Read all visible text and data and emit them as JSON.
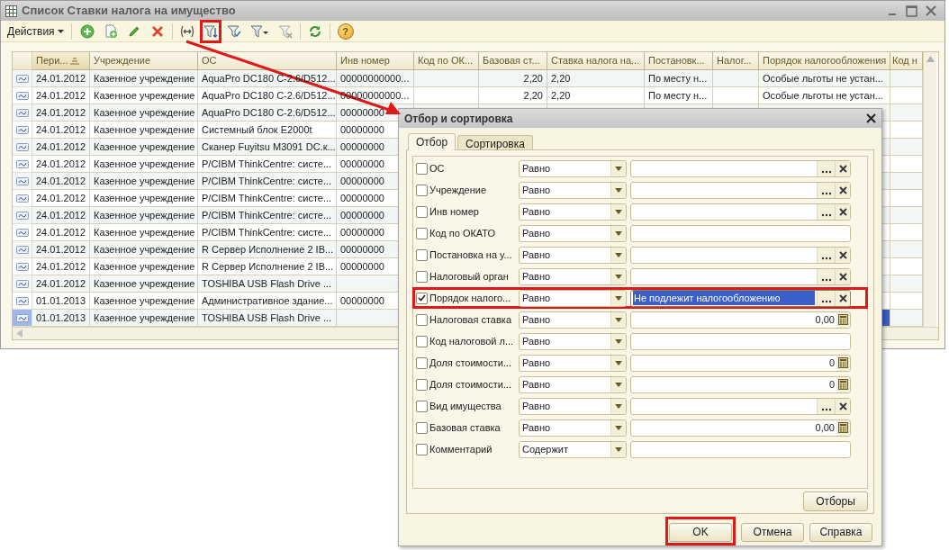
{
  "window": {
    "title": "Список Ставки налога на имущество"
  },
  "toolbar": {
    "actions_label": "Действия",
    "buttons": [
      {
        "kind": "add",
        "annotated": false
      },
      {
        "kind": "copy",
        "annotated": false
      },
      {
        "kind": "edit",
        "annotated": false
      },
      {
        "kind": "delete",
        "annotated": false
      },
      {
        "kind": "interval",
        "annotated": false
      },
      {
        "kind": "filter-sort",
        "annotated": true
      },
      {
        "kind": "filter-value",
        "annotated": false
      },
      {
        "kind": "filter-menu",
        "annotated": false
      },
      {
        "kind": "filter-clear",
        "annotated": false
      },
      {
        "kind": "refresh",
        "annotated": false
      },
      {
        "kind": "help",
        "annotated": false,
        "glyph": "?"
      }
    ]
  },
  "table": {
    "columns": [
      {
        "label": "Пери...",
        "sorted": true
      },
      {
        "label": "Учреждение",
        "sorted": false
      },
      {
        "label": "ОС",
        "sorted": false
      },
      {
        "label": "Инв номер",
        "sorted": false
      },
      {
        "label": "Код по ОК...",
        "sorted": false
      },
      {
        "label": "Базовая ст...",
        "sorted": false
      },
      {
        "label": "Ставка налога на...",
        "sorted": false
      },
      {
        "label": "Постановк...",
        "sorted": false
      },
      {
        "label": "Налог...",
        "sorted": false
      },
      {
        "label": "Порядок налогообложения",
        "sorted": false
      },
      {
        "label": "Код н",
        "sorted": false
      }
    ],
    "rows": [
      {
        "selected": false,
        "cells": [
          "24.01.2012",
          "Казенное учреждение",
          "AquaPro DC180 C-2.6/D512...",
          "00000000000...",
          null,
          "2,20",
          "2,20",
          "По месту н...",
          null,
          "Особые льготы не устан...",
          null
        ]
      },
      {
        "selected": false,
        "cells": [
          "24.01.2012",
          "Казенное учреждение",
          "AquaPro DC180 C-2.6/D512...",
          "00000000000...",
          null,
          "2,20",
          "2,20",
          "По месту н...",
          null,
          "Особые льготы не устан...",
          null
        ]
      },
      {
        "selected": false,
        "cells": [
          "24.01.2012",
          "Казенное учреждение",
          "AquaPro DC180 C-2.6/D512...",
          "00000000"
        ]
      },
      {
        "selected": false,
        "cells": [
          "24.01.2012",
          "Казенное учреждение",
          "Системный блок E2000t",
          "00000000"
        ]
      },
      {
        "selected": false,
        "cells": [
          "24.01.2012",
          "Казенное учреждение",
          "Сканер Fuyitsu M3091 DC.к...",
          "00000000"
        ]
      },
      {
        "selected": false,
        "cells": [
          "24.01.2012",
          "Казенное учреждение",
          "P/CIBM ThinkCentre: систе...",
          "00000000"
        ]
      },
      {
        "selected": false,
        "cells": [
          "24.01.2012",
          "Казенное учреждение",
          "P/CIBM ThinkCentre: систе...",
          "00000000"
        ]
      },
      {
        "selected": false,
        "cells": [
          "24.01.2012",
          "Казенное учреждение",
          "P/CIBM ThinkCentre: систе...",
          "00000000"
        ]
      },
      {
        "selected": false,
        "cells": [
          "24.01.2012",
          "Казенное учреждение",
          "P/CIBM ThinkCentre: систе...",
          "00000000"
        ]
      },
      {
        "selected": false,
        "cells": [
          "24.01.2012",
          "Казенное учреждение",
          "P/CIBM ThinkCentre: систе...",
          "00000000"
        ]
      },
      {
        "selected": false,
        "cells": [
          "24.01.2012",
          "Казенное учреждение",
          "R Сервер Исполнение 2 IB...",
          "00000000"
        ]
      },
      {
        "selected": false,
        "cells": [
          "24.01.2012",
          "Казенное учреждение",
          "R Сервер Исполнение 2 IB...",
          "00000000"
        ]
      },
      {
        "selected": false,
        "cells": [
          "24.01.2012",
          "Казенное учреждение",
          "TOSHIBA USB Flash Drive ...",
          null
        ]
      },
      {
        "selected": false,
        "cells": [
          "01.01.2013",
          "Казенное учреждение",
          "Административное здание...",
          "00000000"
        ]
      },
      {
        "selected": true,
        "cells": [
          "01.01.2013",
          "Казенное учреждение",
          "TOSHIBA USB Flash Drive ...",
          null
        ]
      }
    ]
  },
  "dialog": {
    "title": "Отбор и сортировка",
    "tabs": [
      {
        "label": "Отбор",
        "selected": true
      },
      {
        "label": "Сортировка",
        "selected": false
      }
    ],
    "filters": [
      {
        "label": "ОС",
        "checked": false,
        "condition": "Равно",
        "kind": "ref",
        "focused": false,
        "annotated": false
      },
      {
        "label": "Учреждение",
        "checked": false,
        "condition": "Равно",
        "kind": "ref",
        "focused": false,
        "annotated": false
      },
      {
        "label": "Инв номер",
        "checked": false,
        "condition": "Равно",
        "kind": "ref",
        "focused": false,
        "annotated": false
      },
      {
        "label": "Код по ОКАТО",
        "checked": false,
        "condition": "Равно",
        "kind": "plain",
        "focused": false,
        "annotated": false
      },
      {
        "label": "Постановка на у...",
        "checked": false,
        "condition": "Равно",
        "kind": "ref",
        "focused": false,
        "annotated": false
      },
      {
        "label": "Налоговый орган",
        "checked": false,
        "condition": "Равно",
        "kind": "ref",
        "focused": false,
        "annotated": false
      },
      {
        "label": "Порядок налого...",
        "checked": true,
        "condition": "Равно",
        "kind": "ref",
        "value": "Не подлежит налогообложению",
        "focused": true,
        "annotated": true
      },
      {
        "label": "Налоговая ставка",
        "checked": false,
        "condition": "Равно",
        "kind": "number",
        "value": "0,00",
        "focused": false,
        "annotated": false
      },
      {
        "label": "Код налоговой л...",
        "checked": false,
        "condition": "Равно",
        "kind": "plain",
        "focused": false,
        "annotated": false
      },
      {
        "label": "Доля стоимости...",
        "checked": false,
        "condition": "Равно",
        "kind": "number",
        "value": "0",
        "focused": false,
        "annotated": false
      },
      {
        "label": "Доля стоимости...",
        "checked": false,
        "condition": "Равно",
        "kind": "number",
        "value": "0",
        "focused": false,
        "annotated": false
      },
      {
        "label": "Вид имущества",
        "checked": false,
        "condition": "Равно",
        "kind": "ref",
        "focused": false,
        "annotated": false
      },
      {
        "label": "Базовая ставка",
        "checked": false,
        "condition": "Равно",
        "kind": "number",
        "value": "0,00",
        "focused": false,
        "annotated": false
      },
      {
        "label": "Комментарий",
        "checked": false,
        "condition": "Содержит",
        "kind": "plain",
        "focused": false,
        "annotated": false
      }
    ],
    "filters_button": "Отборы",
    "buttons": [
      {
        "label": "OK",
        "annotated": true
      },
      {
        "label": "Отмена",
        "annotated": false
      },
      {
        "label": "Справка",
        "annotated": false
      }
    ]
  }
}
